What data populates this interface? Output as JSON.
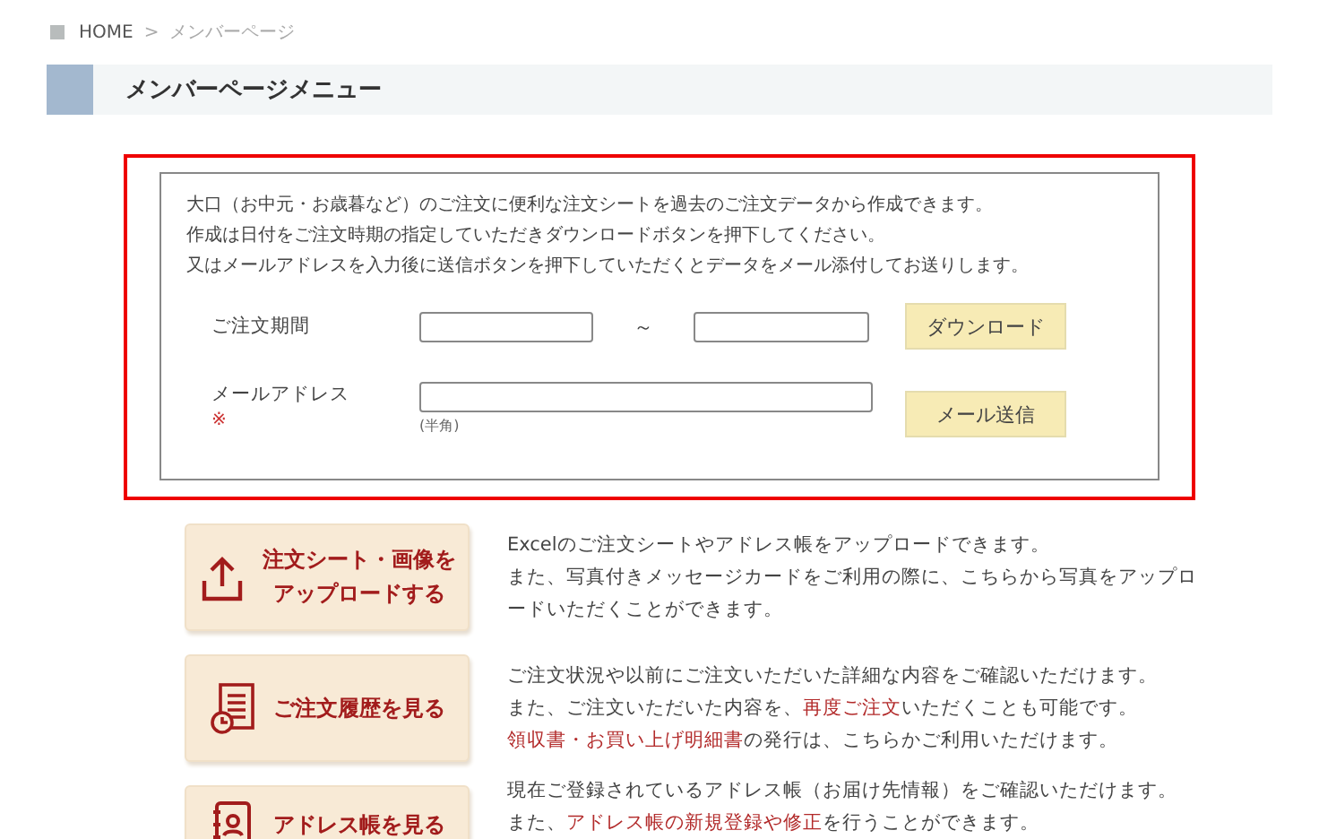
{
  "breadcrumb": [
    {
      "label": "HOME",
      "current": false
    },
    {
      "label": "メンバーページ",
      "current": true
    }
  ],
  "breadcrumb_separator": ">",
  "heading": "メンバーページメニュー",
  "order_sheet": {
    "intro": [
      "大口（お中元・お歳暮など）のご注文に便利な注文シートを過去のご注文データから作成できます。",
      "作成は日付をご注文時期の指定していただきダウンロードボタンを押下してください。",
      "又はメールアドレスを入力後に送信ボタンを押下していただくとデータをメール添付してお送りします。"
    ],
    "period_label": "ご注文期間",
    "period_separator": "～",
    "download_button": "ダウンロード",
    "email_label": "メールアドレス",
    "required_mark": "※",
    "email_hint": "(半角)",
    "send_button": "メール送信"
  },
  "menu": [
    {
      "kind": "upload",
      "label_lines": [
        "注文シート・画像を",
        "アップロードする"
      ],
      "description": [
        [
          {
            "text": "Excelのご注文シートやアドレス帳をアップロードできます。",
            "link": false
          }
        ],
        [
          {
            "text": "また、写真付きメッセージカードをご利用の際に、こちらから写真をアップロ",
            "link": false
          }
        ],
        [
          {
            "text": "ードいただくことができます。",
            "link": false
          }
        ]
      ]
    },
    {
      "kind": "history",
      "label_lines": [
        "ご注文履歴を見る"
      ],
      "description": [
        [
          {
            "text": "ご注文状況や以前にご注文いただいた詳細な内容をご確認いただけます。",
            "link": false
          }
        ],
        [
          {
            "text": "また、ご注文いただいた内容を、",
            "link": false
          },
          {
            "text": "再度ご注文",
            "link": true
          },
          {
            "text": "いただくことも可能です。",
            "link": false
          }
        ],
        [
          {
            "text": "領収書・お買い上げ明細書",
            "link": true
          },
          {
            "text": "の発行は、こちらかご利用いただけます。",
            "link": false
          }
        ]
      ]
    },
    {
      "kind": "address",
      "label_lines": [
        "アドレス帳を見る"
      ],
      "description": [
        [
          {
            "text": "現在ご登録されているアドレス帳（お届け先情報）をご確認いただけます。",
            "link": false
          }
        ],
        [
          {
            "text": "また、",
            "link": false
          },
          {
            "text": "アドレス帳の新規登録や修正",
            "link": true
          },
          {
            "text": "を行うことができます。",
            "link": false
          }
        ]
      ]
    }
  ]
}
